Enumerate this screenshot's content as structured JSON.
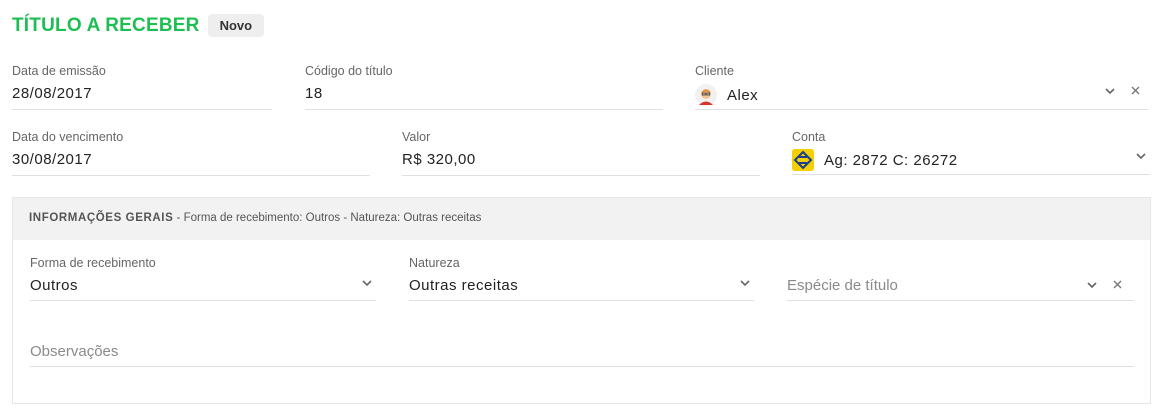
{
  "header": {
    "title": "TÍTULO A RECEBER",
    "badge": "Novo"
  },
  "fields": {
    "data_emissao": {
      "label": "Data de emissão",
      "value": "28/08/2017"
    },
    "codigo_titulo": {
      "label": "Código do título",
      "value": "18"
    },
    "cliente": {
      "label": "Cliente",
      "value": "Alex"
    },
    "data_vencimento": {
      "label": "Data do vencimento",
      "value": "30/08/2017"
    },
    "valor": {
      "label": "Valor",
      "value": "R$ 320,00"
    },
    "conta": {
      "label": "Conta",
      "value": "Ag: 2872 C: 26272"
    }
  },
  "panel": {
    "title": "INFORMAÇÕES GERAIS",
    "summary": " - Forma de recebimento: Outros - Natureza: Outras receitas",
    "forma_recebimento": {
      "label": "Forma de recebimento",
      "value": "Outros"
    },
    "natureza": {
      "label": "Natureza",
      "value": "Outras receitas"
    },
    "especie": {
      "placeholder": "Espécie de título"
    },
    "observacoes": {
      "placeholder": "Observações"
    }
  },
  "colors": {
    "title_green": "#1dbf53",
    "bank_yellow": "#f5d000",
    "bank_blue": "#1a3e8c"
  },
  "icons": {
    "cliente": "avatar",
    "conta": "banco-do-brasil-logo",
    "dropdown": "chevron-down-icon",
    "clear": "close-icon"
  }
}
